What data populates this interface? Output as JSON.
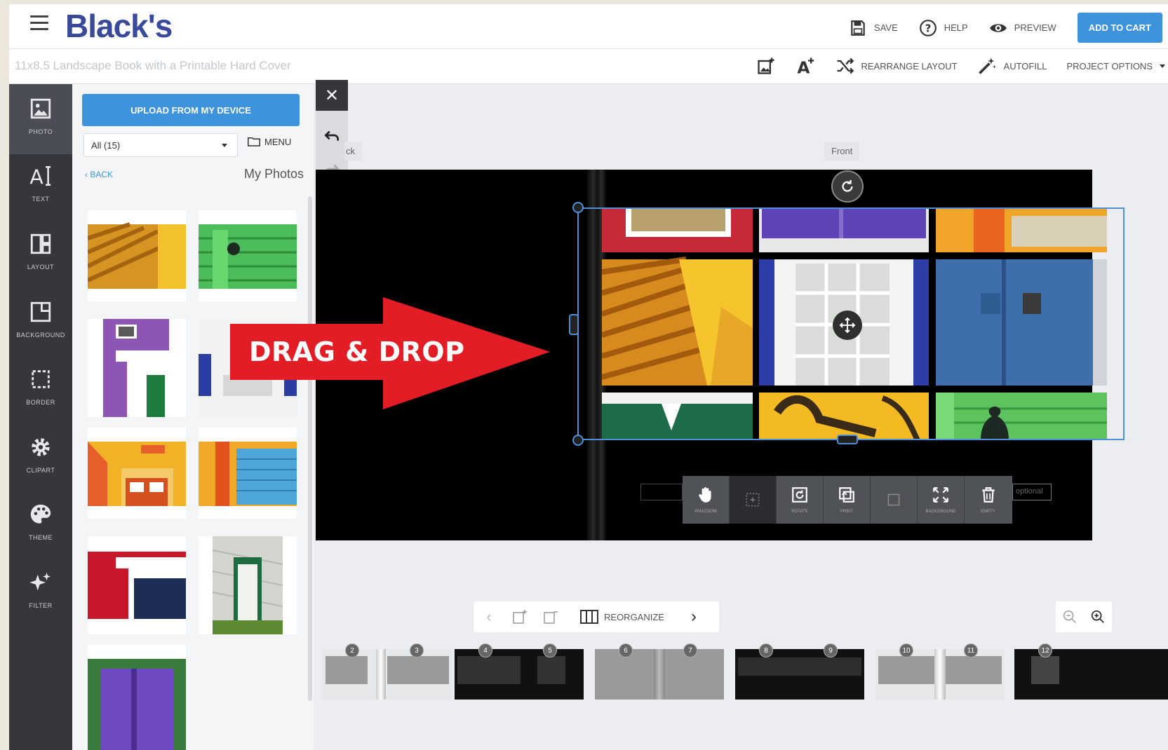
{
  "header": {
    "brand": "Black's",
    "actions": [
      {
        "label": "SAVE",
        "icon": "save-icon"
      },
      {
        "label": "HELP",
        "icon": "help-icon"
      },
      {
        "label": "PREVIEW",
        "icon": "eye-icon"
      }
    ],
    "cart_label": "ADD TO CART",
    "cart_color": "#3d94dd"
  },
  "subheader": {
    "project_title": "11x8.5 Landscape Book with a Printable Hard Cover",
    "rearrange_label": "REARRANGE LAYOUT",
    "autofill_label": "AUTOFILL",
    "project_options_label": "PROJECT OPTIONS"
  },
  "rail": {
    "items": [
      {
        "label": "PHOTO",
        "icon": "photo-icon"
      },
      {
        "label": "TEXT",
        "icon": "text-icon"
      },
      {
        "label": "LAYOUT",
        "icon": "layout-icon"
      },
      {
        "label": "BACKGROUND",
        "icon": "background-icon"
      },
      {
        "label": "BORDER",
        "icon": "border-icon"
      },
      {
        "label": "CLIPART",
        "icon": "gear-icon"
      },
      {
        "label": "THEME",
        "icon": "palette-icon"
      },
      {
        "label": "FILTER",
        "icon": "sparkle-icon"
      }
    ]
  },
  "panel": {
    "upload_label": "UPLOAD FROM MY DEVICE",
    "album_select": "All (15)",
    "menu_label": "MENU",
    "back_label": "BACK",
    "section_title": "My Photos"
  },
  "canvas": {
    "back_tag": "ck",
    "front_tag": "Front",
    "overlay_text": "DRAG & DROP",
    "optional_text": "optional",
    "selection_color": "#4f8fd8",
    "arrow_color": "#e21d26"
  },
  "toolbar": {
    "items": [
      {
        "label": "PAN/ZOOM",
        "icon": "hand-icon"
      },
      {
        "label": "",
        "icon": "crop-frame-icon"
      },
      {
        "label": "ROTATE",
        "icon": "rotate-box-icon"
      },
      {
        "label": "PRINT",
        "icon": "print-icon"
      },
      {
        "label": "",
        "icon": "copy-dim-icon"
      },
      {
        "label": "BACKGROUND",
        "icon": "expand-icon"
      },
      {
        "label": "EMPTY",
        "icon": "trash-icon"
      }
    ]
  },
  "pager": {
    "reorganize_label": "REORGANIZE"
  },
  "filmstrip": {
    "pages": [
      "2",
      "3",
      "4",
      "5",
      "6",
      "7",
      "8",
      "9",
      "10",
      "11",
      "12"
    ]
  }
}
